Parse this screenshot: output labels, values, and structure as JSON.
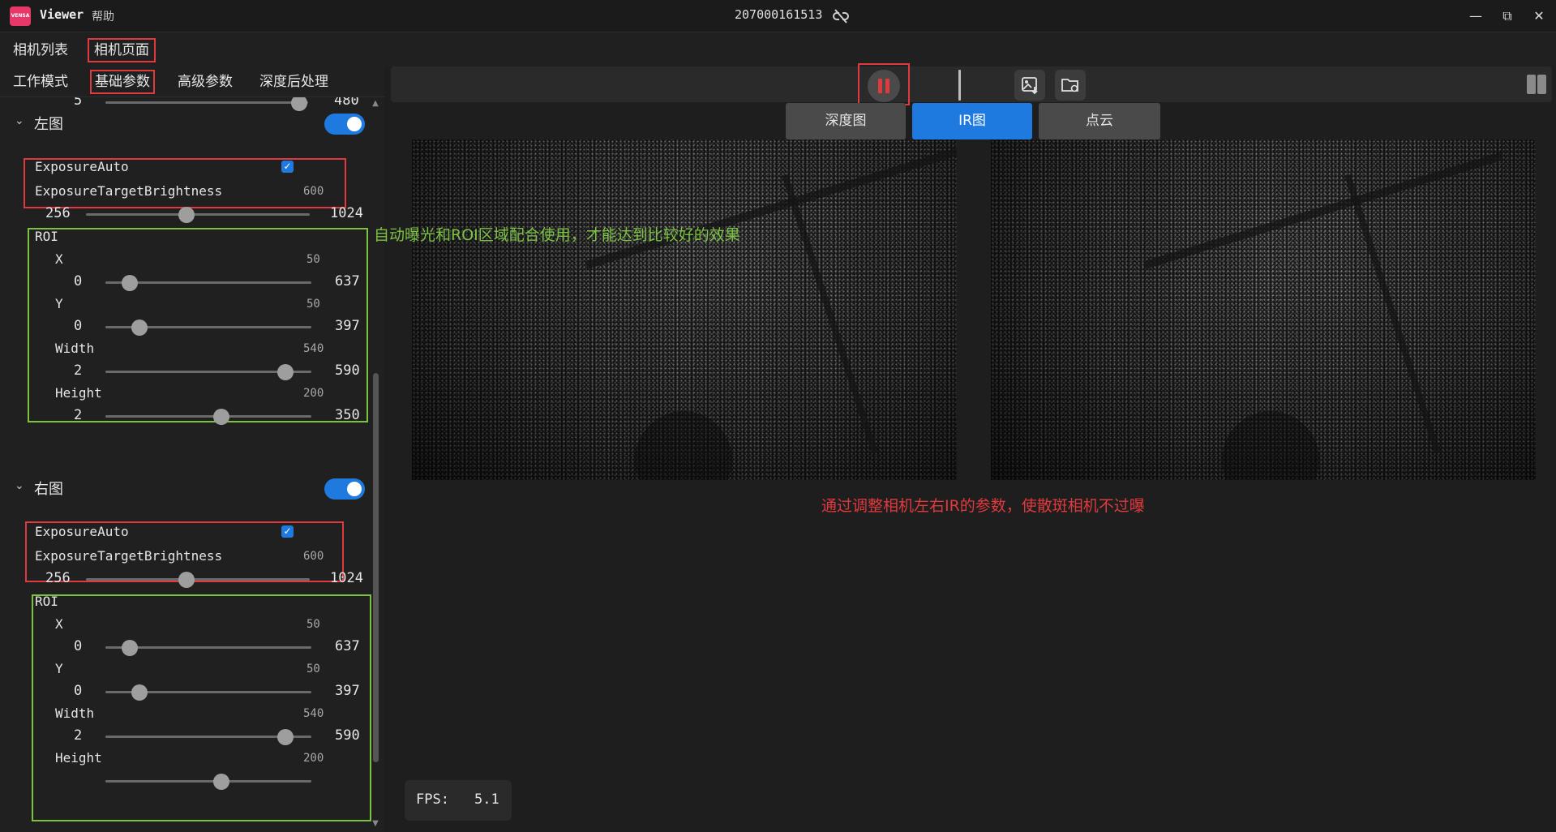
{
  "titlebar": {
    "logo_text": "VENSA",
    "app_name": "Viewer",
    "help_menu": "帮助",
    "serial": "207000161513",
    "status_icon": "unlink-icon"
  },
  "top_tabs": [
    {
      "label": "相机列表"
    },
    {
      "label": "相机页面",
      "active": true
    }
  ],
  "sub_tabs": [
    {
      "label": "工作模式"
    },
    {
      "label": "基础参数",
      "active": true
    },
    {
      "label": "高级参数"
    },
    {
      "label": "深度后处理"
    }
  ],
  "partial_slider": {
    "min": "5",
    "max": "480",
    "value_fraction": 0.95
  },
  "left_image": {
    "title": "左图",
    "enabled": true,
    "exposure_auto": {
      "label": "ExposureAuto",
      "checked": true
    },
    "target_brightness": {
      "label": "ExposureTargetBrightness",
      "value": "600",
      "min": "256",
      "max": "1024"
    },
    "roi": {
      "label": "ROI",
      "x": {
        "label": "X",
        "value": "50",
        "min": "0",
        "max": "637"
      },
      "y": {
        "label": "Y",
        "value": "50",
        "min": "0",
        "max": "397"
      },
      "width": {
        "label": "Width",
        "value": "540",
        "min": "2",
        "max": "590"
      },
      "height": {
        "label": "Height",
        "value": "200",
        "min": "2",
        "max": "350"
      }
    }
  },
  "right_image": {
    "title": "右图",
    "enabled": true,
    "exposure_auto": {
      "label": "ExposureAuto",
      "checked": true
    },
    "target_brightness": {
      "label": "ExposureTargetBrightness",
      "value": "600",
      "min": "256",
      "max": "1024"
    },
    "roi": {
      "label": "ROI",
      "x": {
        "label": "X",
        "value": "50",
        "min": "0",
        "max": "637"
      },
      "y": {
        "label": "Y",
        "value": "50",
        "min": "0",
        "max": "397"
      },
      "width": {
        "label": "Width",
        "value": "540",
        "min": "2",
        "max": "590"
      },
      "height": {
        "label": "Height",
        "value": "200"
      }
    }
  },
  "toolbar": {
    "pause_icon": "pause-icon",
    "save_image_icon": "save-image-icon",
    "folder_settings_icon": "folder-settings-icon",
    "layout_icon": "split-layout-icon"
  },
  "view_tabs": [
    {
      "label": "深度图"
    },
    {
      "label": "IR图",
      "active": true
    },
    {
      "label": "点云"
    }
  ],
  "annotations": {
    "green_note": "自动曝光和ROI区域配合使用，才能达到比较好的效果",
    "red_note": "通过调整相机左右IR的参数，使散斑相机不过曝"
  },
  "fps": {
    "label": "FPS:",
    "value": "5.1"
  },
  "colors": {
    "accent_blue": "#1f7ae0",
    "highlight_red": "#e0393e",
    "highlight_green": "#7cc242",
    "background": "#1e1e1e"
  }
}
